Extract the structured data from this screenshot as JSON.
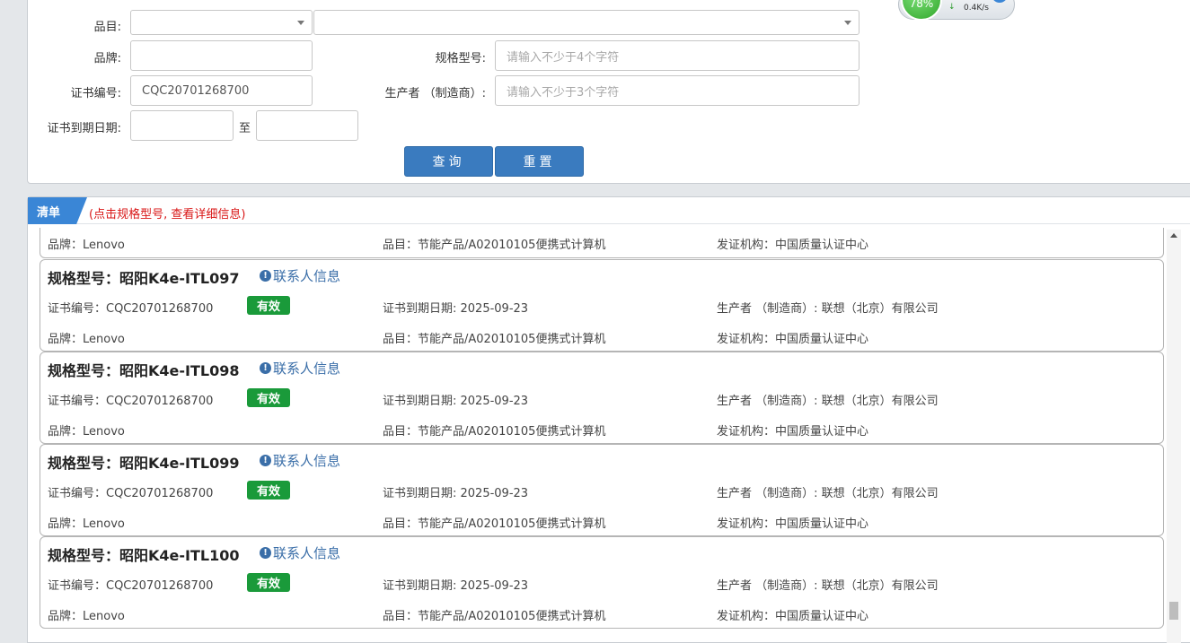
{
  "search": {
    "category_label": "品目:",
    "category_value": "",
    "category_sub_value": "",
    "brand_label": "品牌:",
    "brand_value": "",
    "model_label": "规格型号:",
    "model_placeholder": "请输入不少于4个字符",
    "cert_no_label": "证书编号:",
    "cert_no_value": "CQC20701268700",
    "maker_label": "生产者 （制造商）:",
    "maker_placeholder": "请输入不少于3个字符",
    "expiry_label": "证书到期日期:",
    "expiry_from": "",
    "expiry_sep": "至",
    "expiry_to": "",
    "query_button": "查询",
    "reset_button": "重置"
  },
  "widget": {
    "percent": "78%",
    "speed": "0.4K/s",
    "speed_arrow": "↓",
    "plus": "+"
  },
  "list": {
    "tab_label": "清单",
    "hint": "(点击规格型号, 查看详细信息)",
    "partial": {
      "brand": "品牌：Lenovo",
      "category": "品目：节能产品/A02010105便携式计算机",
      "issuer": "发证机构：中国质量认证中心"
    },
    "items": [
      {
        "title": "规格型号：昭阳K4e-ITL097",
        "contact": "联系人信息",
        "cert_no": "证书编号：CQC20701268700",
        "status": "有效",
        "expiry": "证书到期日期: 2025-09-23",
        "maker": "生产者 （制造商）: 联想（北京）有限公司",
        "brand": "品牌：Lenovo",
        "category": "品目：节能产品/A02010105便携式计算机",
        "issuer": "发证机构：中国质量认证中心"
      },
      {
        "title": "规格型号：昭阳K4e-ITL098",
        "contact": "联系人信息",
        "cert_no": "证书编号：CQC20701268700",
        "status": "有效",
        "expiry": "证书到期日期: 2025-09-23",
        "maker": "生产者 （制造商）: 联想（北京）有限公司",
        "brand": "品牌：Lenovo",
        "category": "品目：节能产品/A02010105便携式计算机",
        "issuer": "发证机构：中国质量认证中心"
      },
      {
        "title": "规格型号：昭阳K4e-ITL099",
        "contact": "联系人信息",
        "cert_no": "证书编号：CQC20701268700",
        "status": "有效",
        "expiry": "证书到期日期: 2025-09-23",
        "maker": "生产者 （制造商）: 联想（北京）有限公司",
        "brand": "品牌：Lenovo",
        "category": "品目：节能产品/A02010105便携式计算机",
        "issuer": "发证机构：中国质量认证中心"
      },
      {
        "title": "规格型号：昭阳K4e-ITL100",
        "contact": "联系人信息",
        "cert_no": "证书编号：CQC20701268700",
        "status": "有效",
        "expiry": "证书到期日期: 2025-09-23",
        "maker": "生产者 （制造商）: 联想（北京）有限公司",
        "brand": "品牌：Lenovo",
        "category": "品目：节能产品/A02010105便携式计算机",
        "issuer": "发证机构：中国质量认证中心"
      }
    ]
  },
  "colors": {
    "primary_button": "#3a7bbf",
    "tab": "#3a86d6",
    "hint": "#d91616",
    "badge_valid": "#1a9a3a",
    "link": "#3a6ea8"
  }
}
